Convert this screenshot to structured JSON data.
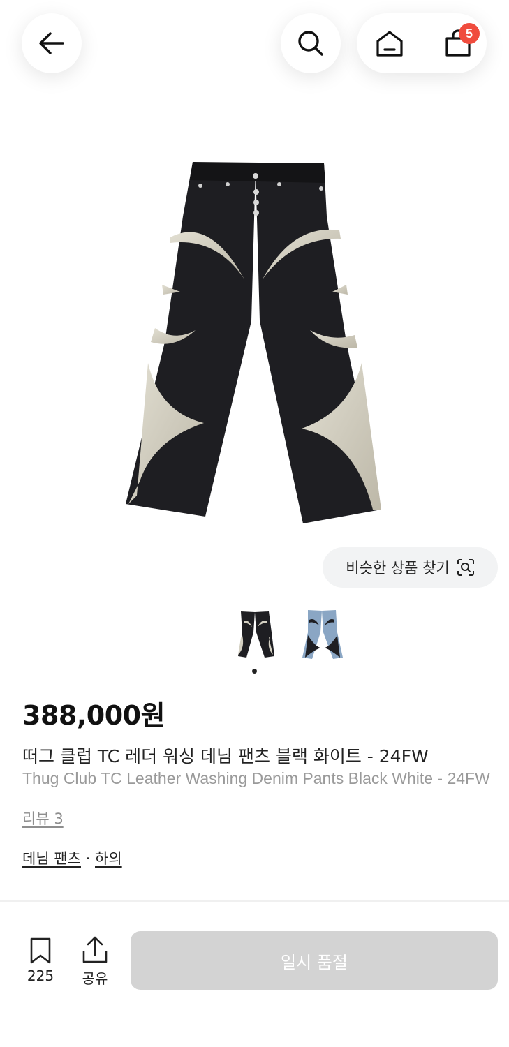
{
  "header": {
    "back_icon": "arrow-left-icon",
    "search_icon": "search-icon",
    "home_icon": "home-icon",
    "cart_icon": "shopping-bag-icon",
    "cart_count": "5",
    "badge_color": "#f04c3e"
  },
  "similar": {
    "label": "비슷한 상품 찾기",
    "icon": "image-search-icon"
  },
  "gallery": {
    "count": 2,
    "active_index": 0
  },
  "product": {
    "price": "388,000원",
    "name_ko": "떠그 클럽 TC 레더 워싱 데님 팬츠 블랙 화이트 - 24FW",
    "name_en": "Thug Club TC Leather Washing Denim Pants Black White - 24FW",
    "review_label": "리뷰 3",
    "category_sub": "데님 팬츠",
    "category_sep": " · ",
    "category_main": "하의"
  },
  "bottom": {
    "bookmark_count": "225",
    "share_label": "공유",
    "buy_label": "일시 품절"
  }
}
